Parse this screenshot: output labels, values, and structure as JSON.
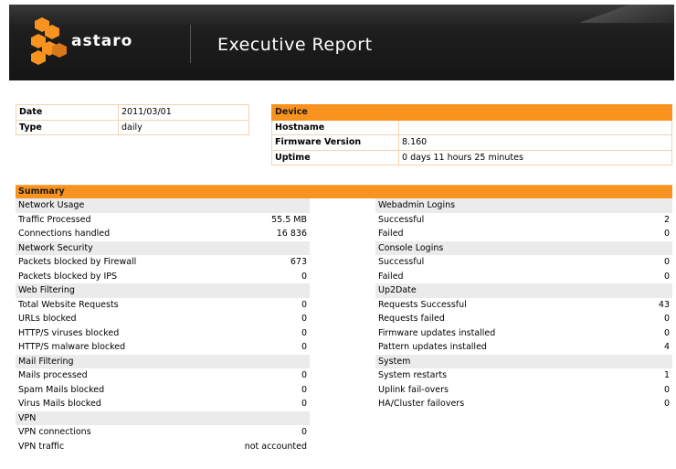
{
  "header": {
    "brand": "astaro",
    "title": "Executive Report"
  },
  "info": [
    {
      "label": "Date",
      "value": "2011/03/01"
    },
    {
      "label": "Type",
      "value": "daily"
    }
  ],
  "device": {
    "heading": "Device",
    "rows": [
      {
        "label": "Hostname",
        "value": ""
      },
      {
        "label": "Firmware Version",
        "value": "8.160"
      },
      {
        "label": "Uptime",
        "value": "0 days 11 hours 25 minutes"
      }
    ]
  },
  "summary": {
    "heading": "Summary",
    "rows": [
      {
        "l": "Network Usage",
        "lv": "",
        "r": "Webadmin Logins",
        "rv": "",
        "lsec": true,
        "rsec": true
      },
      {
        "l": "Traffic Processed",
        "lv": "55.5 MB",
        "r": "Successful",
        "rv": "2"
      },
      {
        "l": "Connections handled",
        "lv": "16 836",
        "r": "Failed",
        "rv": "0"
      },
      {
        "l": "Network Security",
        "lv": "",
        "r": "Console Logins",
        "rv": "",
        "lsec": true,
        "rsec": true
      },
      {
        "l": "Packets blocked by Firewall",
        "lv": "673",
        "r": "Successful",
        "rv": "0"
      },
      {
        "l": "Packets blocked by IPS",
        "lv": "0",
        "r": "Failed",
        "rv": "0"
      },
      {
        "l": "Web Filtering",
        "lv": "",
        "r": "Up2Date",
        "rv": "",
        "lsec": true,
        "rsec": true
      },
      {
        "l": "Total Website Requests",
        "lv": "0",
        "r": "Requests Successful",
        "rv": "43"
      },
      {
        "l": "URLs blocked",
        "lv": "0",
        "r": "Requests failed",
        "rv": "0"
      },
      {
        "l": "HTTP/S viruses blocked",
        "lv": "0",
        "r": "Firmware updates installed",
        "rv": "0"
      },
      {
        "l": "HTTP/S malware blocked",
        "lv": "0",
        "r": "Pattern updates installed",
        "rv": "4"
      },
      {
        "l": "Mail Filtering",
        "lv": "",
        "r": "System",
        "rv": "",
        "lsec": true,
        "rsec": true
      },
      {
        "l": "Mails processed",
        "lv": "0",
        "r": "System restarts",
        "rv": "1"
      },
      {
        "l": "Spam Mails blocked",
        "lv": "0",
        "r": "Uplink fail-overs",
        "rv": "0"
      },
      {
        "l": "Virus Mails blocked",
        "lv": "0",
        "r": "HA/Cluster failovers",
        "rv": "0"
      },
      {
        "l": "VPN",
        "lv": "",
        "r": "",
        "rv": "",
        "lsec": true
      },
      {
        "l": "VPN connections",
        "lv": "0",
        "r": "",
        "rv": ""
      },
      {
        "l": "VPN traffic",
        "lv": "not accounted",
        "r": "",
        "rv": ""
      }
    ]
  },
  "colors": {
    "accent": "#f7931e",
    "banner": "#1c1c1c",
    "section_row": "#ebebeb"
  }
}
